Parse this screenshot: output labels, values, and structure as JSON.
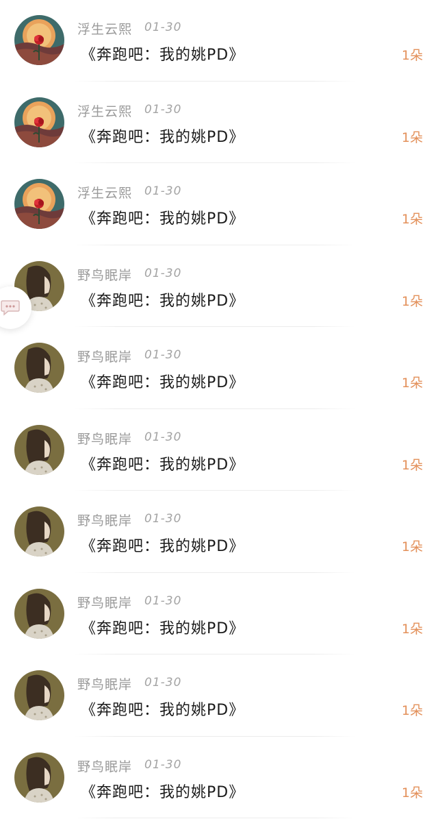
{
  "comments": [
    {
      "avatar": "rose-moon-avatar",
      "user": "浮生云熙",
      "date": "01-30",
      "text": "《奔跑吧：我的姚PD》",
      "count": "1朵"
    },
    {
      "avatar": "rose-moon-avatar",
      "user": "浮生云熙",
      "date": "01-30",
      "text": "《奔跑吧：我的姚PD》",
      "count": "1朵"
    },
    {
      "avatar": "rose-moon-avatar",
      "user": "浮生云熙",
      "date": "01-30",
      "text": "《奔跑吧：我的姚PD》",
      "count": "1朵"
    },
    {
      "avatar": "girl-profile-avatar",
      "user": "野鸟眠岸",
      "date": "01-30",
      "text": "《奔跑吧：我的姚PD》",
      "count": "1朵"
    },
    {
      "avatar": "girl-profile-avatar",
      "user": "野鸟眠岸",
      "date": "01-30",
      "text": "《奔跑吧：我的姚PD》",
      "count": "1朵"
    },
    {
      "avatar": "girl-profile-avatar",
      "user": "野鸟眠岸",
      "date": "01-30",
      "text": "《奔跑吧：我的姚PD》",
      "count": "1朵"
    },
    {
      "avatar": "girl-profile-avatar",
      "user": "野鸟眠岸",
      "date": "01-30",
      "text": "《奔跑吧：我的姚PD》",
      "count": "1朵"
    },
    {
      "avatar": "girl-profile-avatar",
      "user": "野鸟眠岸",
      "date": "01-30",
      "text": "《奔跑吧：我的姚PD》",
      "count": "1朵"
    },
    {
      "avatar": "girl-profile-avatar",
      "user": "野鸟眠岸",
      "date": "01-30",
      "text": "《奔跑吧：我的姚PD》",
      "count": "1朵"
    },
    {
      "avatar": "girl-profile-avatar",
      "user": "野鸟眠岸",
      "date": "01-30",
      "text": "《奔跑吧：我的姚PD》",
      "count": "1朵"
    }
  ],
  "floating_button": {
    "icon": "chat-bubble-icon"
  },
  "colors": {
    "username": "#9a9a9a",
    "date": "#a3a3a3",
    "title": "#1a1a1a",
    "count_accent": "#e3905a"
  }
}
